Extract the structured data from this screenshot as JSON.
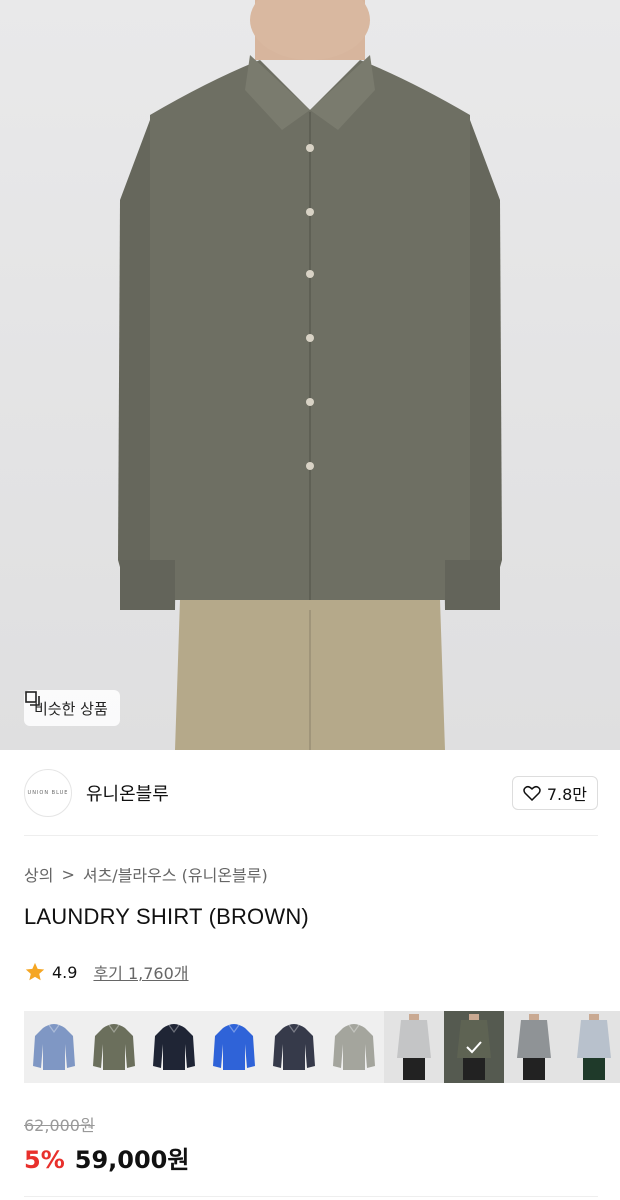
{
  "hero": {
    "similar_label": "비슷한 상품"
  },
  "brand": {
    "logo_text": "UNION BLUE",
    "name": "유니온블루",
    "likes": "7.8만"
  },
  "breadcrumb": {
    "category": "상의",
    "separator": ">",
    "subcategory": "셔츠/블라우스 (유니온블루)"
  },
  "product": {
    "title": "LAUNDRY SHIRT (BROWN)",
    "rating": "4.9",
    "reviews": "후기 1,760개"
  },
  "swatches": [
    {
      "color": "#7f97c4",
      "kind": "flat",
      "icon": "shirt-light-blue"
    },
    {
      "color": "#6b6f5c",
      "kind": "flat",
      "icon": "shirt-khaki"
    },
    {
      "color": "#1f2535",
      "kind": "flat",
      "icon": "shirt-navy"
    },
    {
      "color": "#2f63d8",
      "kind": "flat",
      "icon": "shirt-blue"
    },
    {
      "color": "#363a4a",
      "kind": "flat",
      "icon": "shirt-charcoal"
    },
    {
      "color": "#a4a59d",
      "kind": "flat",
      "icon": "shirt-gray"
    },
    {
      "color": "#c4c5c6",
      "kind": "photo",
      "icon": "model-gray"
    },
    {
      "color": "#5e6353",
      "kind": "photo",
      "icon": "model-brown",
      "selected": true
    },
    {
      "color": "#8f9396",
      "kind": "photo",
      "icon": "model-charcoal"
    },
    {
      "color": "#b8c1cc",
      "kind": "photo",
      "icon": "model-light-blue"
    }
  ],
  "price": {
    "original": "62,000원",
    "discount": "5%",
    "final": "59,000원"
  },
  "colors": {
    "discount": "#e8302c",
    "star": "#f5a623"
  }
}
